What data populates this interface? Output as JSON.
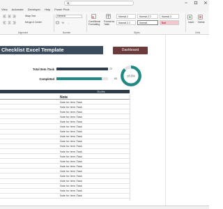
{
  "search": {
    "placeholder": ""
  },
  "menu": {
    "tabs": [
      "View",
      "Automate",
      "Developer",
      "Help",
      "Power Pivot"
    ]
  },
  "ribbon": {
    "wrap_text": "Wrap Text",
    "merge_center": "Merge & Center",
    "number_format": "General",
    "conditional_formatting": "Conditional Formatting",
    "format_as_table": "Format as Table",
    "groups": {
      "alignment": "Alignment",
      "number": "Number",
      "styles": "Styles",
      "cells": "Cells"
    },
    "styles": {
      "normal_2": "Normal 2",
      "normal_2_2": "Normal 2 2",
      "normal_3": "Normal 3",
      "normal_2_b": "Normal 2 2",
      "normal": "Normal",
      "bad": "Bad"
    },
    "insert": "Insert",
    "delete": "Delete"
  },
  "sheet": {
    "title": "Checklist Excel Template",
    "dashboard_button": "Dashboard",
    "total_label": "Total Item /Task",
    "total_value": "72",
    "completed_label": "Completed",
    "completed_value": "63",
    "completed_fraction": 0.875,
    "donut_label": "±8.5%",
    "percent_bar_text": "70.0%",
    "note_header": "Note",
    "rows": [
      "Note for Item /Task",
      "Note for Item /Task",
      "Note for Item /Task",
      "Note for Item /Task",
      "Note for Item /Task",
      "Note for Item /Task",
      "Note for Item /Task",
      "Note for Item /Task",
      "Note for Item /Task",
      "Note for Item /Task",
      "Note for Item /Task",
      "Note for Item /Task",
      "Note for Item /Task",
      "Note for Item /Task",
      "Note for Item /Task",
      "Note for Item /Task",
      "Note for Item /Task",
      "Note for Item /Task",
      "Note for Item /Task",
      "Note for Item /Task"
    ]
  },
  "colors": {
    "banner": "#3b4c5e",
    "dashboard": "#6b3a3a",
    "total_bar": "#2f3e4c",
    "completed_bar": "#1f8a84",
    "donut": "#1f8a84",
    "bad_style": "#f4c7ce"
  },
  "icons": [
    "search-icon",
    "minimize-icon",
    "maximize-icon",
    "close-icon"
  ]
}
